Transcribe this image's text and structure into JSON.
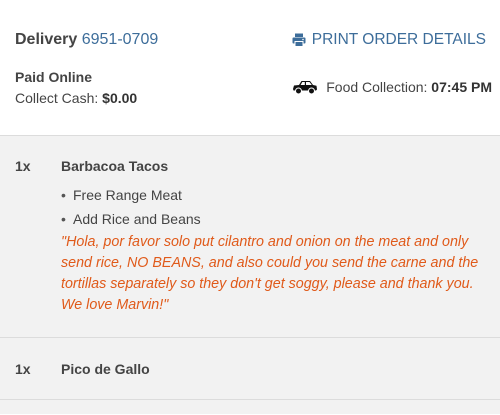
{
  "header": {
    "delivery_label": "Delivery",
    "delivery_number": "6951-0709",
    "print_label": "PRINT ORDER DETAILS",
    "print_icon": "printer-icon",
    "payment_status": "Paid Online",
    "collect_cash_label": "Collect Cash:",
    "collect_cash_value": "$0.00",
    "collection_icon": "car-icon",
    "collection_label": "Food Collection:",
    "collection_time": "07:45 PM"
  },
  "items": [
    {
      "qty": "1x",
      "name": "Barbacoa Tacos",
      "modifiers": [
        "Free Range Meat",
        "Add Rice and Beans"
      ],
      "note": "\"Hola, por favor solo put cilantro and onion on the meat and only send rice, NO BEANS, and also could you send the carne and the tortillas separately so they don't get soggy, please and thank you. We love Marvin!\""
    },
    {
      "qty": "1x",
      "name": "Pico de Gallo"
    }
  ],
  "colors": {
    "link": "#3d6d9a",
    "note": "#e05a1a",
    "item_background": "#f2f2f2"
  }
}
